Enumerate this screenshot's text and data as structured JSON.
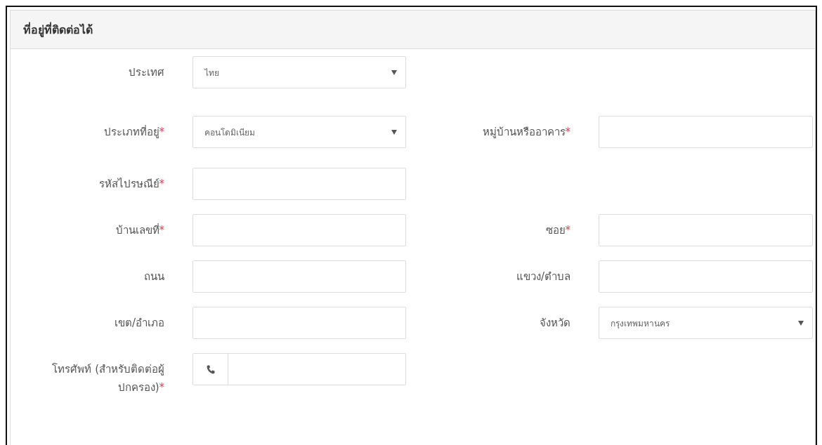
{
  "panel": {
    "title": "ที่อยู่ที่ติดต่อได้"
  },
  "rows": [
    {
      "left": {
        "label": "ประเทศ",
        "kind": "select",
        "value": "ไทย"
      }
    },
    {
      "left": {
        "label": "ประเภทที่อยู่",
        "required_mark": "*",
        "kind": "select",
        "value": "คอนโดมิเนียม"
      },
      "right": {
        "label": "หมู่บ้านหรืออาคาร",
        "required_mark": "*",
        "kind": "text"
      }
    },
    {
      "left": {
        "label": "รหัสไปรษณีย์",
        "required_mark": "*",
        "kind": "text"
      }
    },
    {
      "left": {
        "label": "บ้านเลขที่",
        "required_mark": "*",
        "kind": "text"
      },
      "right": {
        "label": "ซอย",
        "required_mark": "*",
        "kind": "text"
      }
    },
    {
      "left": {
        "label": "ถนน",
        "kind": "text"
      },
      "right": {
        "label": "แขวง/ตำบล",
        "kind": "text"
      }
    },
    {
      "left": {
        "label": "เขต/อำเภอ",
        "kind": "text"
      },
      "right": {
        "label": "จังหวัด",
        "kind": "select",
        "value": "กรุงเทพมหานคร"
      }
    },
    {
      "left": {
        "label": "โทรศัพท์ (สำหรับติดต่อผู้ปกครอง)",
        "required_mark": "*",
        "kind": "phone"
      }
    }
  ]
}
